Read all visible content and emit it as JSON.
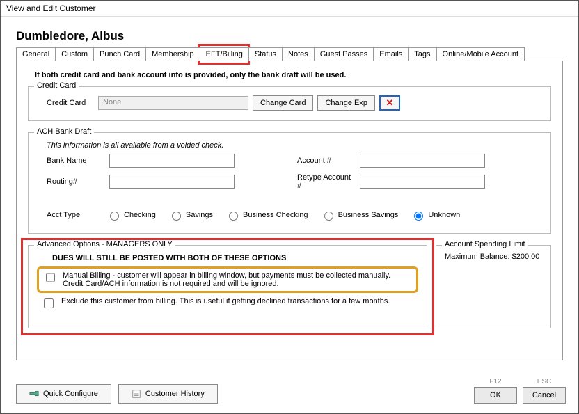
{
  "window": {
    "title": "View and Edit Customer"
  },
  "customer": {
    "name": "Dumbledore, Albus"
  },
  "tabs": {
    "items": [
      "General",
      "Custom",
      "Punch Card",
      "Membership",
      "EFT/Billing",
      "Status",
      "Notes",
      "Guest Passes",
      "Emails",
      "Tags",
      "Online/Mobile Account"
    ],
    "active_index": 4
  },
  "warning": "If both credit card and bank account info is provided, only the bank draft will be used.",
  "credit_card": {
    "legend": "Credit Card",
    "label": "Credit Card",
    "value": "None",
    "change_card": "Change Card",
    "change_exp": "Change Exp"
  },
  "ach": {
    "legend": "ACH Bank Draft",
    "note": "This information is all available from a voided check.",
    "bank_name_label": "Bank Name",
    "routing_label": "Routing#",
    "account_label": "Account #",
    "retype_label": "Retype Account #",
    "bank_name": "",
    "routing": "",
    "account": "",
    "retype": "",
    "acct_type_label": "Acct Type",
    "options": [
      "Checking",
      "Savings",
      "Business Checking",
      "Business Savings",
      "Unknown"
    ],
    "selected_index": 4
  },
  "advanced": {
    "legend": "Advanced Options - MANAGERS ONLY",
    "headline": "DUES WILL STILL BE POSTED WITH BOTH OF THESE OPTIONS",
    "opt1": "Manual Billing - customer will appear in billing window, but payments must be collected manually. Credit Card/ACH information is not required and will be ignored.",
    "opt2": "Exclude this customer from billing.  This is useful if getting declined transactions for a few months.",
    "opt1_checked": false,
    "opt2_checked": false
  },
  "spending": {
    "legend": "Account Spending Limit",
    "text": "Maximum Balance: $200.00"
  },
  "buttons": {
    "quick_configure": "Quick Configure",
    "customer_history": "Customer History",
    "ok": "OK",
    "cancel": "Cancel",
    "f12": "F12",
    "esc": "ESC"
  }
}
